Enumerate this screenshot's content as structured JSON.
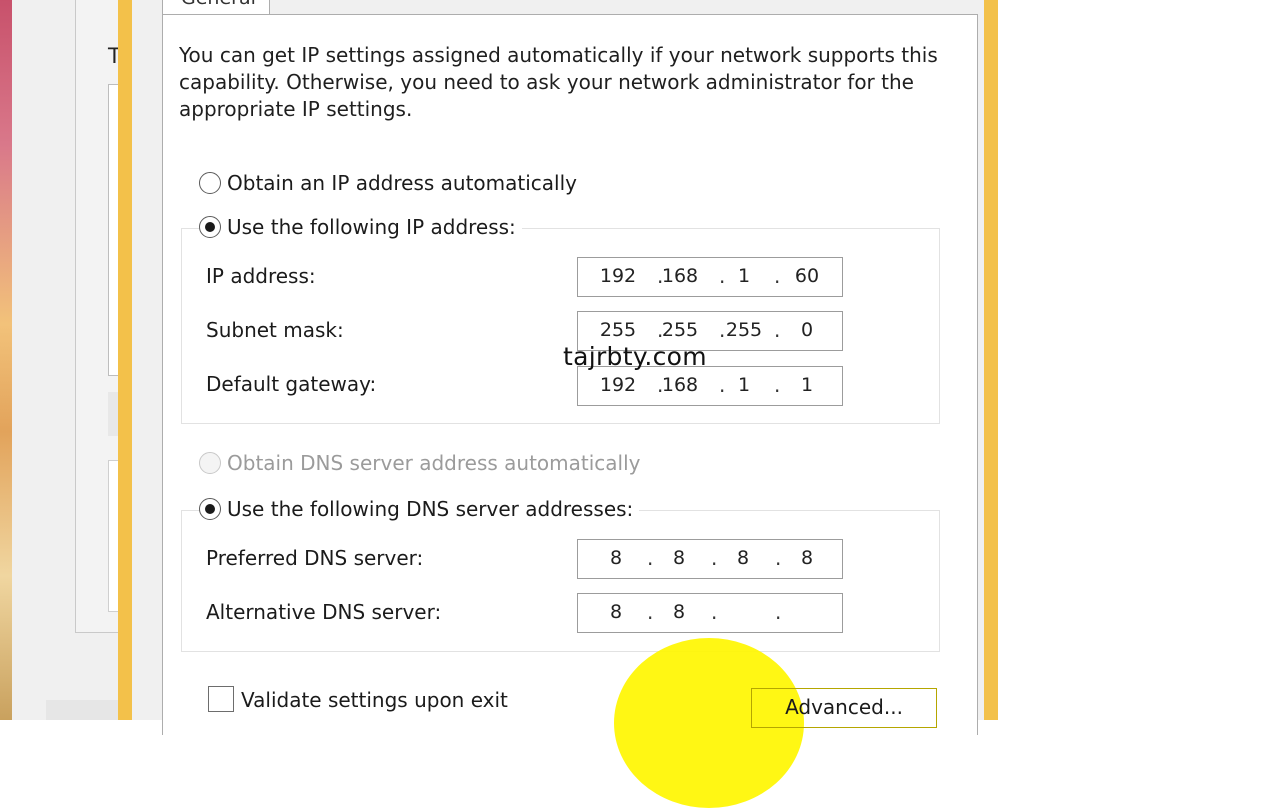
{
  "background_window": {
    "letter": "T"
  },
  "tab": {
    "label": "General"
  },
  "intro_text": "You can get IP settings assigned automatically if your network supports this capability. Otherwise, you need to ask your network administrator for the appropriate IP settings.",
  "ip_mode": {
    "auto_label": "Obtain an IP address automatically",
    "manual_label": "Use the following IP address:",
    "selected": "manual"
  },
  "ip_fields": {
    "ip_address": {
      "label": "IP address:",
      "octets": [
        "192",
        "168",
        "1",
        "60"
      ]
    },
    "subnet_mask": {
      "label": "Subnet mask:",
      "octets": [
        "255",
        "255",
        "255",
        "0"
      ]
    },
    "default_gateway": {
      "label": "Default gateway:",
      "octets": [
        "192",
        "168",
        "1",
        "1"
      ]
    }
  },
  "dns_mode": {
    "auto_label": "Obtain DNS server address automatically",
    "auto_disabled": true,
    "manual_label": "Use the following DNS server addresses:",
    "selected": "manual"
  },
  "dns_fields": {
    "preferred": {
      "label": "Preferred DNS server:",
      "octets": [
        "8",
        "8",
        "8",
        "8"
      ]
    },
    "alternative": {
      "label": "Alternative DNS server:",
      "octets": [
        "8",
        "8",
        "",
        ""
      ]
    }
  },
  "validate": {
    "label": "Validate settings upon exit",
    "checked": false
  },
  "advanced_button": {
    "label": "Advanced..."
  },
  "watermark": "tajrbty.com",
  "colors": {
    "window_border": "#f3c14a",
    "highlight": "#fff600"
  }
}
